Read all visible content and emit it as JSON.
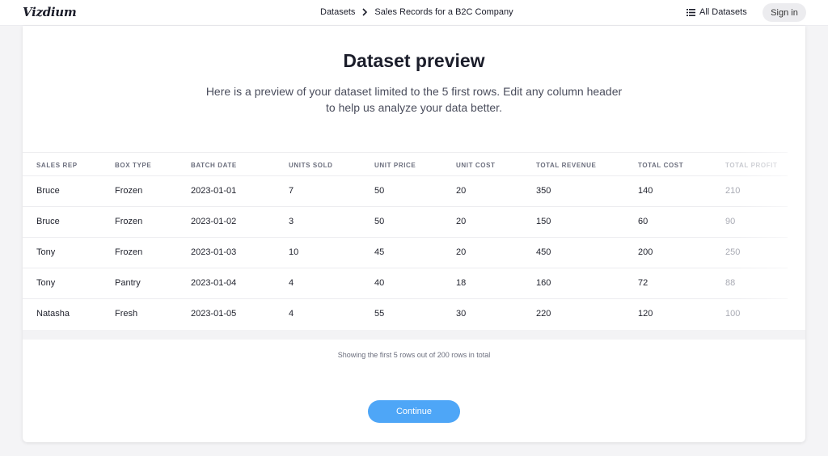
{
  "header": {
    "logo": "Vizdium",
    "breadcrumbs": [
      "Datasets",
      "Sales Records for a B2C Company"
    ],
    "all_datasets_label": "All Datasets",
    "sign_in_label": "Sign in"
  },
  "main": {
    "title": "Dataset preview",
    "subtitle": "Here is a preview of your dataset limited to the 5 first rows. Edit any column header to help us analyze your data better.",
    "table": {
      "columns": [
        "SALES REP",
        "BOX TYPE",
        "BATCH DATE",
        "UNITS SOLD",
        "UNIT PRICE",
        "UNIT COST",
        "TOTAL REVENUE",
        "TOTAL COST",
        "TOTAL PROFIT"
      ],
      "rows": [
        [
          "Bruce",
          "Frozen",
          "2023-01-01",
          "7",
          "50",
          "20",
          "350",
          "140",
          "210"
        ],
        [
          "Bruce",
          "Frozen",
          "2023-01-02",
          "3",
          "50",
          "20",
          "150",
          "60",
          "90"
        ],
        [
          "Tony",
          "Frozen",
          "2023-01-03",
          "10",
          "45",
          "20",
          "450",
          "200",
          "250"
        ],
        [
          "Tony",
          "Pantry",
          "2023-01-04",
          "4",
          "40",
          "18",
          "160",
          "72",
          "88"
        ],
        [
          "Natasha",
          "Fresh",
          "2023-01-05",
          "4",
          "55",
          "30",
          "220",
          "120",
          "100"
        ]
      ]
    },
    "footnote": "Showing the first 5 rows out of 200 rows in total",
    "continue_label": "Continue"
  },
  "colors": {
    "accent": "#4ea6f7",
    "background": "#f4f4f6"
  }
}
